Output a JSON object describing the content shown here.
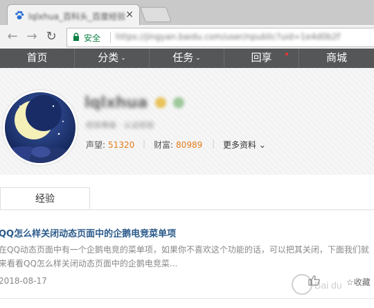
{
  "browser": {
    "tab_title": "lqlxhua_百科头_百度经验",
    "tab_close": "×",
    "secure_label": "安全",
    "url": "https://jingyan.baidu.com/user/npublic?uid=1e4d0b2f"
  },
  "site_nav": {
    "items": [
      {
        "label": "首页",
        "caret": ""
      },
      {
        "label": "分类",
        "caret": "⌄"
      },
      {
        "label": "任务",
        "caret": "⌄"
      },
      {
        "label": "回享",
        "caret": ""
      },
      {
        "label": "商城",
        "caret": ""
      }
    ]
  },
  "profile": {
    "username": "lqlxhua",
    "subtitle": "经验等级 · 认证经验",
    "reputation_label": "声望:",
    "reputation_value": "51320",
    "wealth_label": "财富:",
    "wealth_value": "80989",
    "more_label": "更多资料",
    "more_caret": "⌄",
    "pipe1": "|",
    "pipe2": "|"
  },
  "tabs": [
    {
      "label": "经验"
    }
  ],
  "article": {
    "title": "QQ怎么样关闭动态页面中的企鹅电竞菜单项",
    "description": "在QQ动态页面中有一个企鹅电竞的菜单项，如果你不喜欢这个功能的话，可以把其关闭，下面我们就来看看QQ怎么样关闭动态页面中的企鹅电竞菜...",
    "date": "2018-08-17",
    "fav_label": "收藏"
  },
  "colors": {
    "nav_bg": "#545658",
    "stat_value": "#e27b1a",
    "title_link": "#2a5a8a",
    "secure_green": "#0b8043"
  },
  "watermark": {
    "text": "Bai du 经验"
  }
}
